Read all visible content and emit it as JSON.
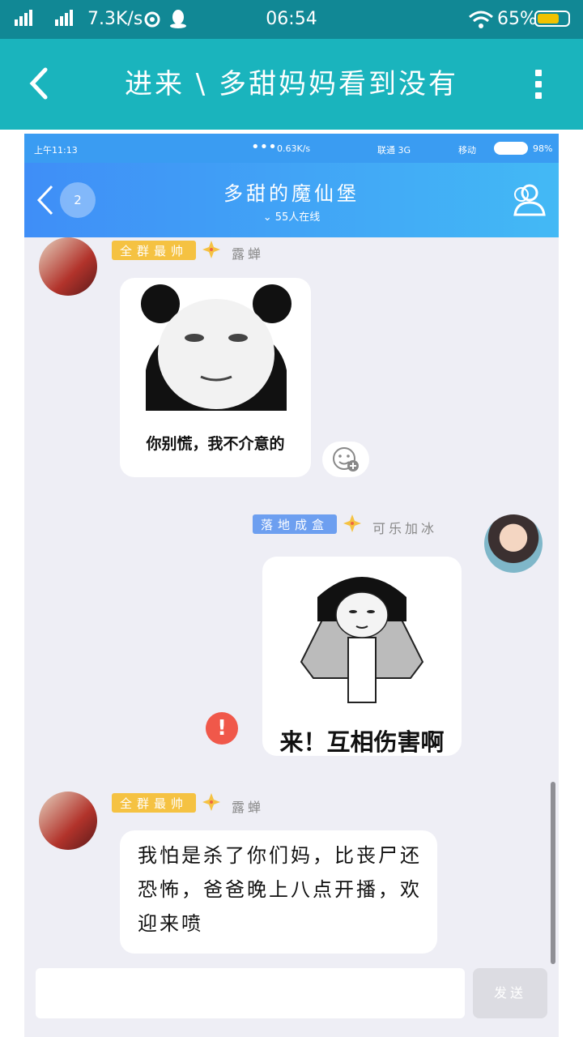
{
  "status_bar": {
    "speed": "7.3K/s",
    "time": "06:54",
    "battery": "65%"
  },
  "title_bar": {
    "title": "进来 \\ 多甜妈妈看到没有"
  },
  "inner": {
    "status": {
      "time": "上午11:13",
      "speed": "0.63K/s",
      "carrier1": "联通 3G",
      "carrier2": "移动",
      "battery": "98%"
    },
    "header": {
      "group_name": "多甜的魔仙堡",
      "online": "55人在线",
      "back_badge": "2"
    },
    "messages": [
      {
        "badge": "全群最帅",
        "nick": "露蝉",
        "caption": "你别慌，我不介意的"
      },
      {
        "badge": "落地成盒",
        "nick": "可乐加冰",
        "caption": "来！互相伤害啊"
      },
      {
        "badge": "全群最帅",
        "nick": "露蝉",
        "text": "我怕是杀了你们妈，比丧尸还恐怖，爸爸晚上八点开播，欢迎来喷"
      }
    ],
    "input": {
      "placeholder": "",
      "send_label": "发送"
    }
  },
  "colors": {
    "status_bg": "#118895",
    "title_bg": "#1ab4bd",
    "inner_header": "#3f8ef7",
    "badge_gold": "#f5c242",
    "badge_blue": "#6d9ff0",
    "alert_red": "#f0584a"
  }
}
